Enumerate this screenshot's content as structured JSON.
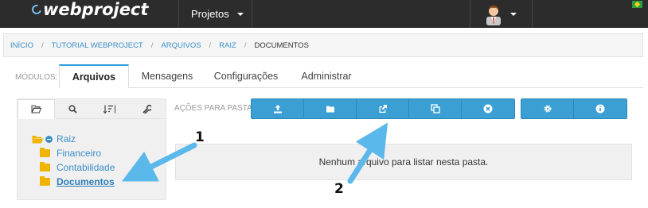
{
  "topbar": {
    "logo_text": "webproject",
    "projects_menu": "Projetos",
    "language": "pt-BR"
  },
  "breadcrumb": {
    "items": [
      "INÍCIO",
      "TUTORIAL WEBPROJECT",
      "ARQUIVOS",
      "RAIZ"
    ],
    "current": "DOCUMENTOS"
  },
  "modules": {
    "label": "MÓDULOS:",
    "tabs": [
      "Arquivos",
      "Mensagens",
      "Configurações",
      "Administrar"
    ],
    "active": "Arquivos"
  },
  "left_panel": {
    "tab_icons": [
      "folder-open-icon",
      "search-icon",
      "sort-icon",
      "wrench-icon"
    ],
    "tree": {
      "root": "Raiz",
      "children": [
        "Financeiro",
        "Contabilidade",
        "Documentos"
      ],
      "selected": "Documentos"
    }
  },
  "actions": {
    "label": "AÇÕES PARA PASTA:",
    "buttons": [
      "upload-icon",
      "folder-icon",
      "share-icon",
      "copy-icon",
      "close-circle-icon"
    ],
    "extra_buttons": [
      "gear-icon",
      "info-icon"
    ]
  },
  "content": {
    "empty_message": "Nenhum arquivo para listar nesta pasta."
  },
  "annotations": {
    "one": "1",
    "two": "2",
    "arrow_color": "#5bb8ea"
  },
  "colors": {
    "accent": "#3b9fd3",
    "topbar": "#2c2c2c",
    "folder": "#f0b400",
    "link": "#3a8fc8"
  }
}
